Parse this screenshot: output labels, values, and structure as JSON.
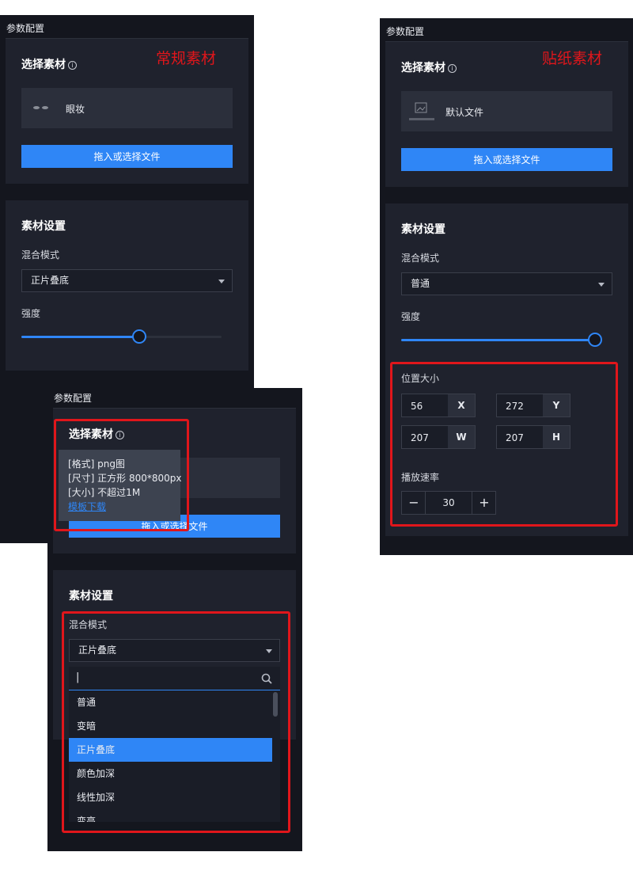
{
  "panel_normal": {
    "title": "参数配置",
    "tag": "常规素材",
    "select_material": {
      "title": "选择素材",
      "info_icon": "i",
      "file_name": "眼妆",
      "upload_label": "拖入或选择文件"
    },
    "settings": {
      "title": "素材设置",
      "blend_label": "混合模式",
      "blend_value": "正片叠底",
      "strength_label": "强度",
      "strength_value": 0.59
    }
  },
  "panel_sticker": {
    "title": "参数配置",
    "tag": "贴纸素材",
    "select_material": {
      "title": "选择素材",
      "info_icon": "i",
      "file_name": "默认文件",
      "upload_label": "拖入或选择文件"
    },
    "settings": {
      "title": "素材设置",
      "blend_label": "混合模式",
      "blend_value": "普通",
      "strength_label": "强度",
      "strength_value": 1.0,
      "position_title": "位置大小",
      "x": {
        "value": "56",
        "unit": "X"
      },
      "y": {
        "value": "272",
        "unit": "Y"
      },
      "w": {
        "value": "207",
        "unit": "W"
      },
      "h": {
        "value": "207",
        "unit": "H"
      },
      "speed_label": "播放速率",
      "speed": {
        "minus": "−",
        "value": "30",
        "plus": "+"
      }
    }
  },
  "panel_dropdown": {
    "title": "参数配置",
    "select_material": {
      "title": "选择素材",
      "info_icon": "i",
      "upload_label_left": "拖入或选择",
      "upload_label_right": "文件"
    },
    "tooltip": {
      "line1": "[格式] png图",
      "line2": "[尺寸] 正方形 800*800px",
      "line3": "[大小] 不超过1M",
      "link": "模板下载"
    },
    "settings": {
      "title": "素材设置",
      "blend_label": "混合模式",
      "blend_value": "正片叠底",
      "search_value": "|"
    },
    "options": [
      "普通",
      "变暗",
      "正片叠底",
      "颜色加深",
      "线性加深",
      "变亮"
    ],
    "selected_option": "正片叠底"
  },
  "colors": {
    "accent": "#2f86f6",
    "highlight_red": "#e0161b",
    "panel_bg": "#14161e",
    "card_bg": "#1f222d"
  }
}
